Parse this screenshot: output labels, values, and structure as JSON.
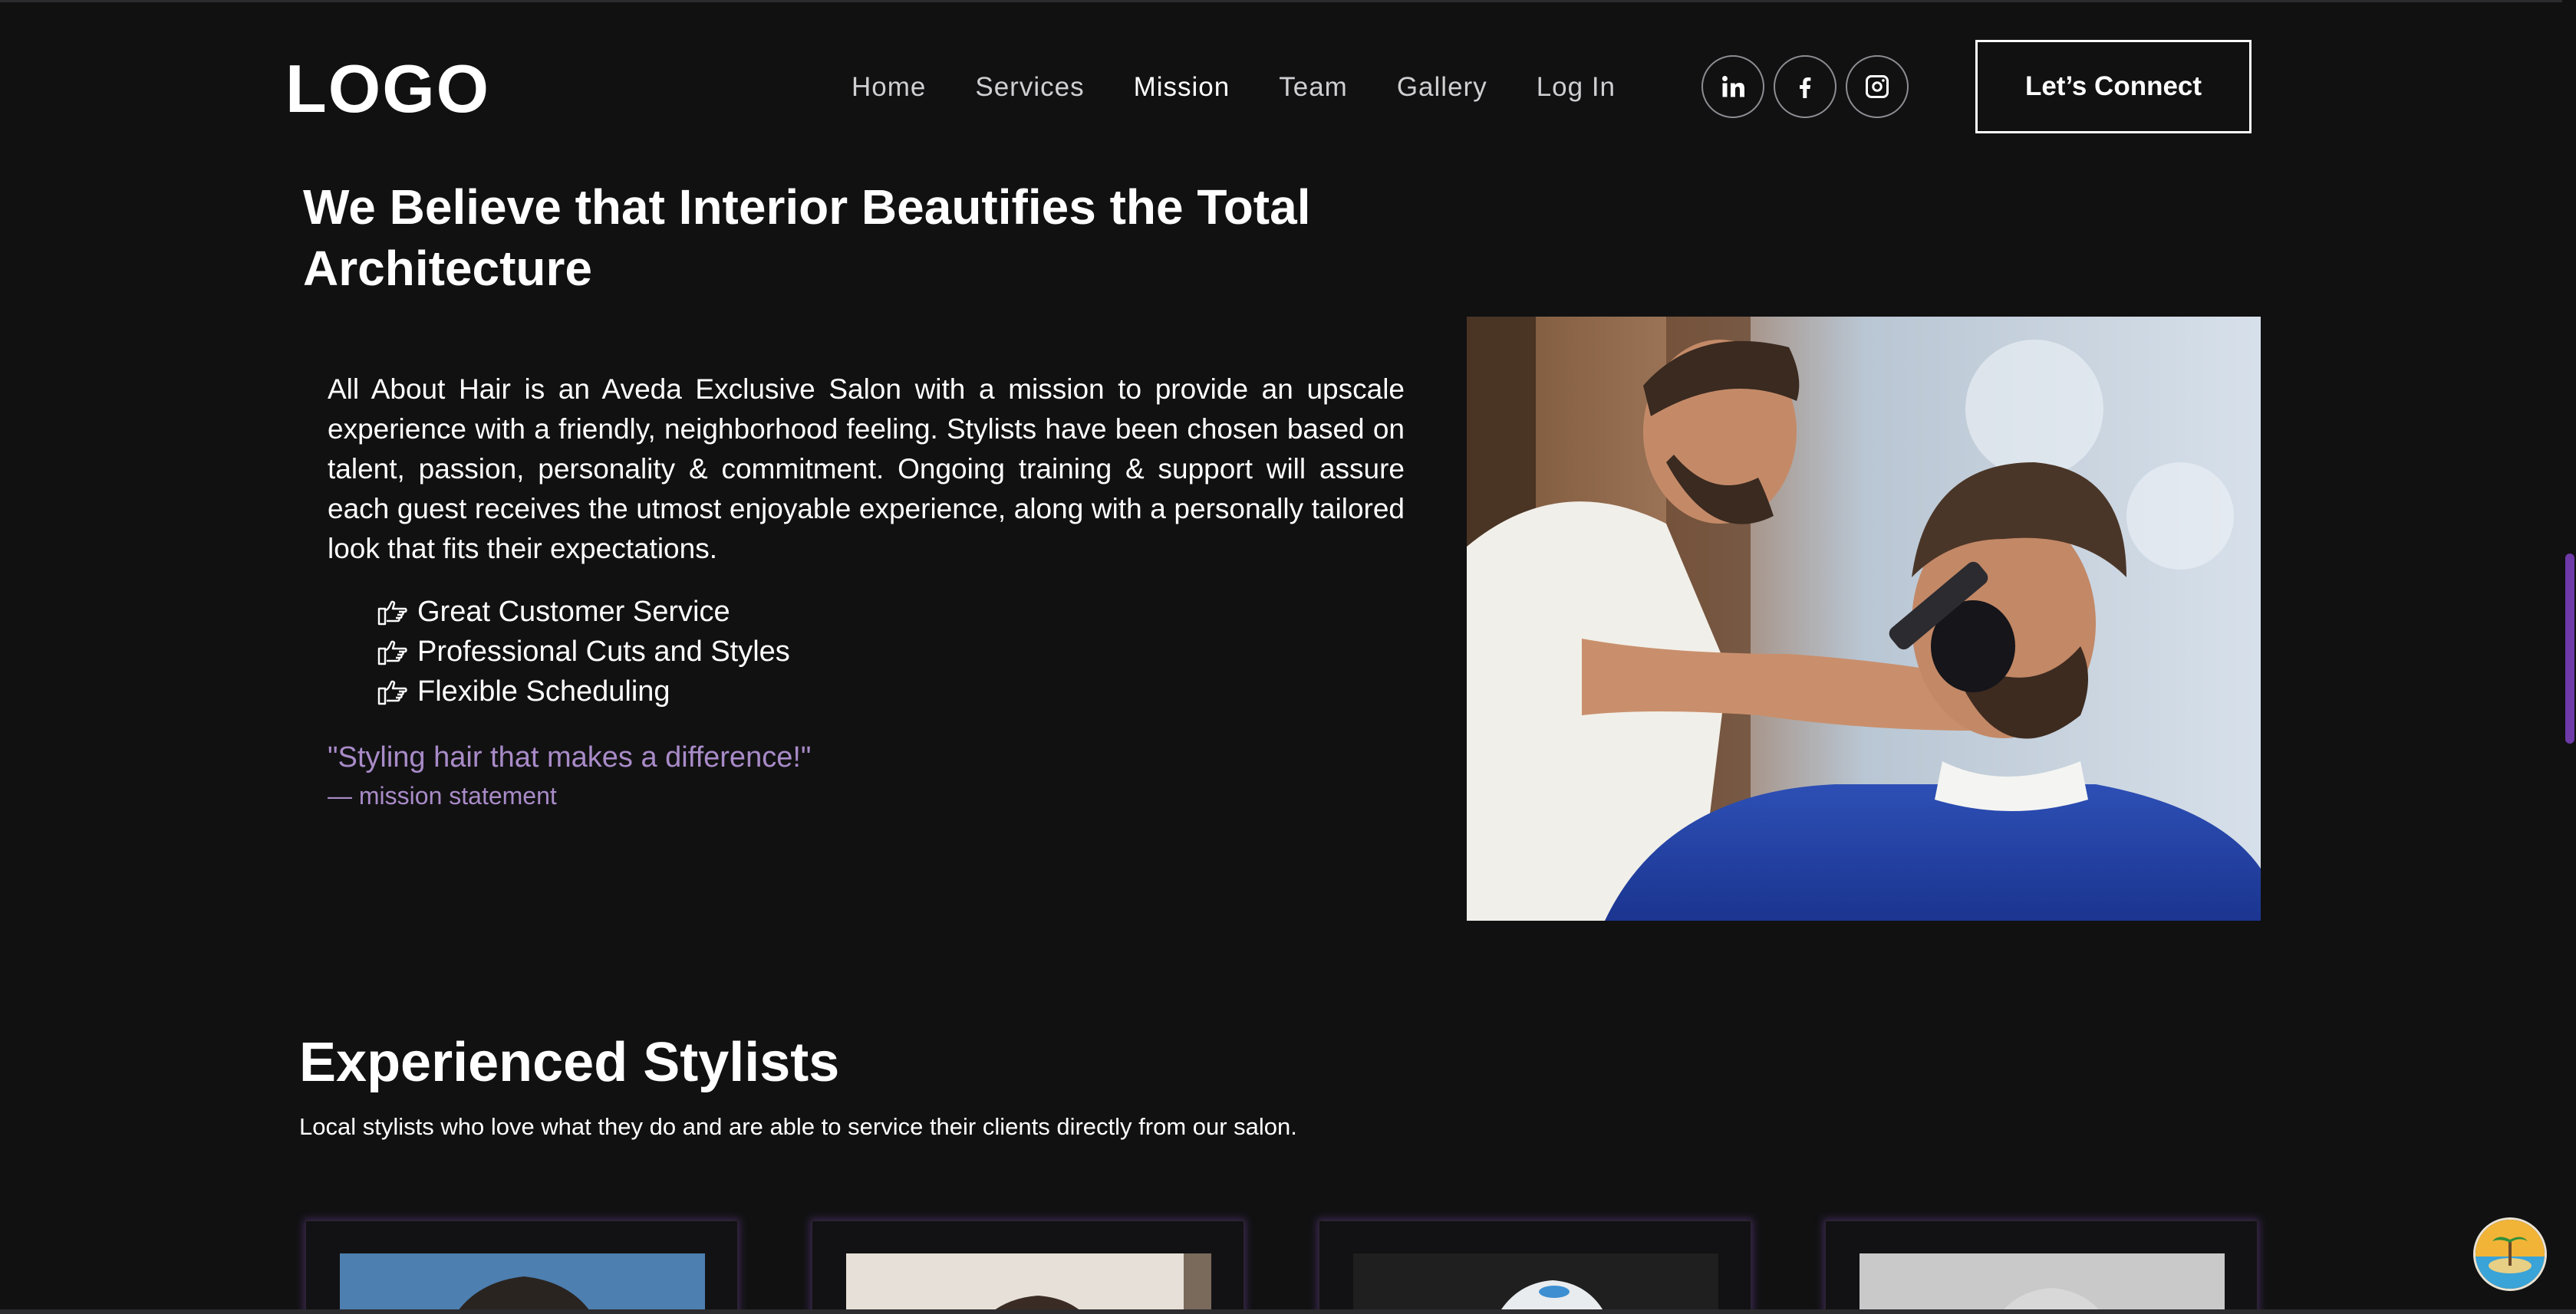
{
  "header": {
    "logo": "LOGO",
    "nav": [
      {
        "label": "Home",
        "active": false
      },
      {
        "label": "Services",
        "active": false
      },
      {
        "label": "Mission",
        "active": true
      },
      {
        "label": "Team",
        "active": false
      },
      {
        "label": "Gallery",
        "active": false
      },
      {
        "label": "Log In",
        "active": false
      }
    ],
    "socials": [
      "linkedin-icon",
      "facebook-icon",
      "instagram-icon"
    ],
    "cta_label": "Let’s Connect"
  },
  "mission": {
    "title": "We Believe that Interior Beautifies the Total Architecture",
    "body": "All About Hair is an Aveda Exclusive Salon with a mission to provide an upscale experience with a friendly, neighborhood feeling. Stylists have been chosen based on talent, passion, personality & commitment. Ongoing training & support will assure each guest receives the utmost enjoyable experience, along with a personally tailored look that fits their expectations.",
    "features": [
      "Great Customer Service",
      "Professional Cuts and Styles",
      "Flexible Scheduling"
    ],
    "quote": "\"Styling hair that makes a difference!\"",
    "quote_source": "— mission statement"
  },
  "stylists": {
    "title": "Experienced Stylists",
    "subtitle": "Local stylists who love what they do and are able to service their clients directly from our salon."
  },
  "colors": {
    "background": "#111112",
    "accent": "#a98bc8",
    "scrollbar": "#6d3aa8"
  }
}
